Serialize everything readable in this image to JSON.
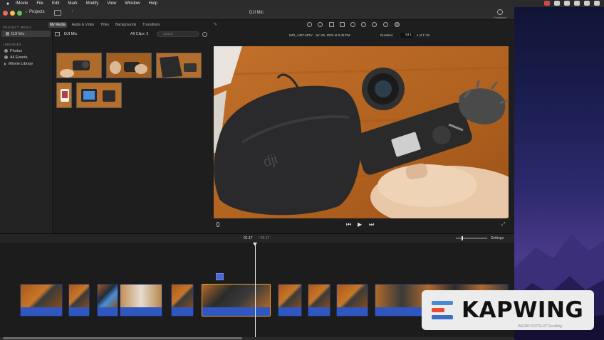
{
  "menubar": {
    "items": [
      "iMovie",
      "File",
      "Edit",
      "Mark",
      "Modify",
      "View",
      "Window",
      "Help"
    ]
  },
  "toolbar": {
    "projects_label": "Projects",
    "window_title": "DJI Mic",
    "feedback_label": "Feedback"
  },
  "media_tabs": [
    {
      "label": "My Media",
      "active": true
    },
    {
      "label": "Audio & Video",
      "active": false
    },
    {
      "label": "Titles",
      "active": false
    },
    {
      "label": "Backgrounds",
      "active": false
    },
    {
      "label": "Transitions",
      "active": false
    }
  ],
  "sidebar": {
    "project_media_header": "PROJECT MEDIA",
    "project_item": "DJI Mic",
    "libraries_header": "LIBRARIES",
    "library_items": [
      "Photos",
      "All Events",
      "iMovie Library"
    ]
  },
  "browser": {
    "title": "DJI Mic",
    "filter": "All Clips",
    "search_placeholder": "Search"
  },
  "viewer": {
    "clip_name": "IMG_1497.MOV - Jun 26, 2022 at 5:48 PM",
    "duration_label": "Duration:",
    "duration_value": "53.1",
    "duration_total": "s of 1:7m"
  },
  "timeline": {
    "timecode": "01:17",
    "total": "/ 06:17",
    "settings_label": "Settings"
  },
  "watermark": {
    "brand": "KAPWING",
    "sub": "WEIRD POTSLOT Scrolling",
    "colors": [
      "#4a8bd6",
      "#e84a3a",
      "#3a6cc8"
    ]
  },
  "colors": {
    "clip_blue": "#2f4fa8",
    "selection_orange": "#f0a030",
    "menubar": "#2b2b2e"
  }
}
